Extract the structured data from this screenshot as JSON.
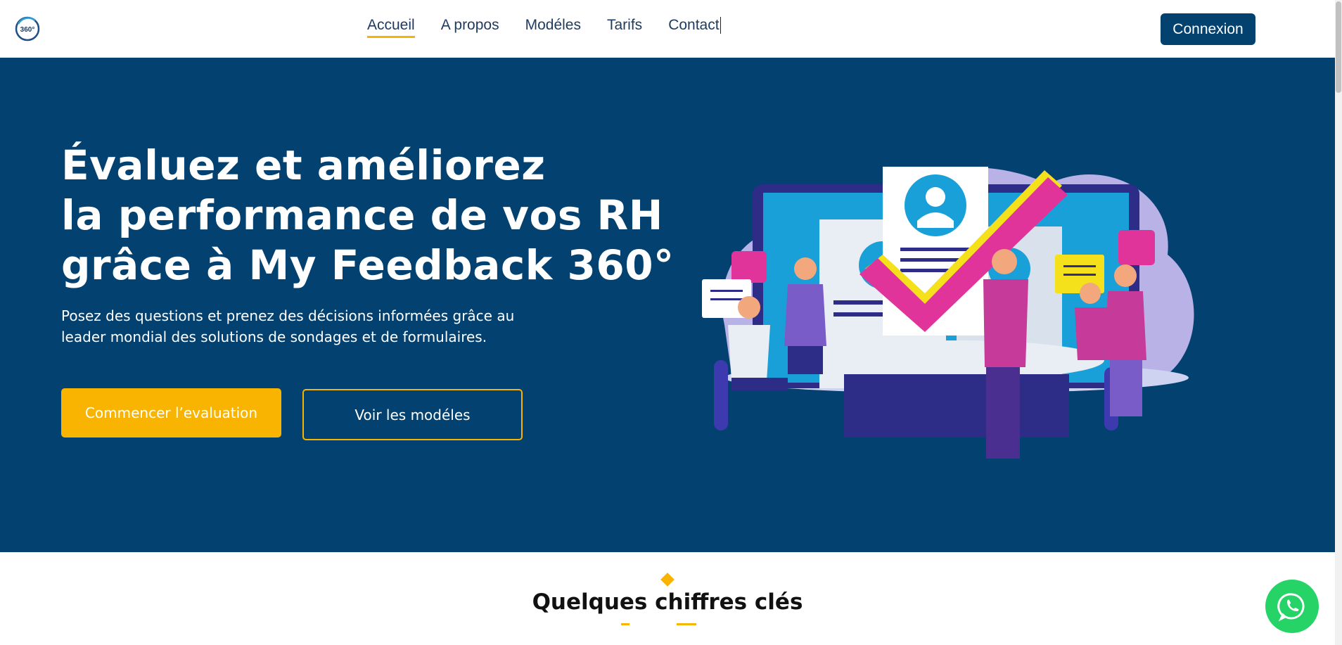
{
  "header": {
    "logo_text": "360°",
    "nav": [
      {
        "label": "Accueil",
        "active": true
      },
      {
        "label": "A propos",
        "active": false
      },
      {
        "label": "Modéles",
        "active": false
      },
      {
        "label": "Tarifs",
        "active": false
      },
      {
        "label": "Contact",
        "active": false
      }
    ],
    "login_label": "Connexion"
  },
  "hero": {
    "title_lines": [
      "Évaluez et améliorez",
      "la performance de vos RH",
      "grâce à My Feedback 360°"
    ],
    "subtitle_lines": [
      "Posez des questions et prenez des décisions informées grâce au",
      "leader mondial des solutions de sondages et de formulaires."
    ],
    "primary_cta": "Commencer l’evaluation",
    "secondary_cta": "Voir les modéles"
  },
  "stats": {
    "title": "Quelques chiffres clés"
  },
  "colors": {
    "brand_navy": "#03416f",
    "accent_yellow": "#f8b400",
    "whatsapp_green": "#25d366"
  }
}
